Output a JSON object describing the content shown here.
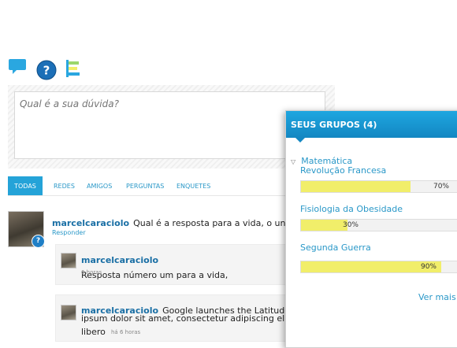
{
  "question_box": {
    "placeholder": "Qual é a sua dúvida?"
  },
  "tabs": [
    {
      "label": "TODAS"
    },
    {
      "label": "REDES"
    },
    {
      "label": "AMIGOS"
    },
    {
      "label": "PERGUNTAS"
    },
    {
      "label": "ENQUETES"
    }
  ],
  "feed": {
    "main_post": {
      "user": "marcelcaraciolo",
      "text": "Qual é a resposta para a vida, o universo",
      "reply_label": "Responder"
    },
    "reply_1": {
      "user": "marcelcaraciolo",
      "text": "Resposta número um para a vida,",
      "time": "6 horas"
    },
    "reply_2": {
      "user": "marcelcaraciolo",
      "text_line1": "Google launches the Latitude API now for developers",
      "text_line2": "ipsum dolor sit amet, consectetur adipiscing elit. Vestibulum et ultrices",
      "text_line3": "libero",
      "time": "há 6 horas"
    }
  },
  "groups_panel": {
    "title": "SEUS GRUPOS (4)",
    "expanded_group": "Matemática",
    "groups": [
      {
        "name": "Revolução Francesa",
        "progress": 70,
        "label": "70%"
      },
      {
        "name": "Fisiologia da Obesidade",
        "progress": 30,
        "label": "30%"
      },
      {
        "name": "Segunda Guerra",
        "progress": 90,
        "label": "90%"
      }
    ],
    "see_more": "Ver mais"
  },
  "colors": {
    "accent": "#24a3d8",
    "bar_fill": "#f1ee6a",
    "link": "#2a98c8"
  }
}
